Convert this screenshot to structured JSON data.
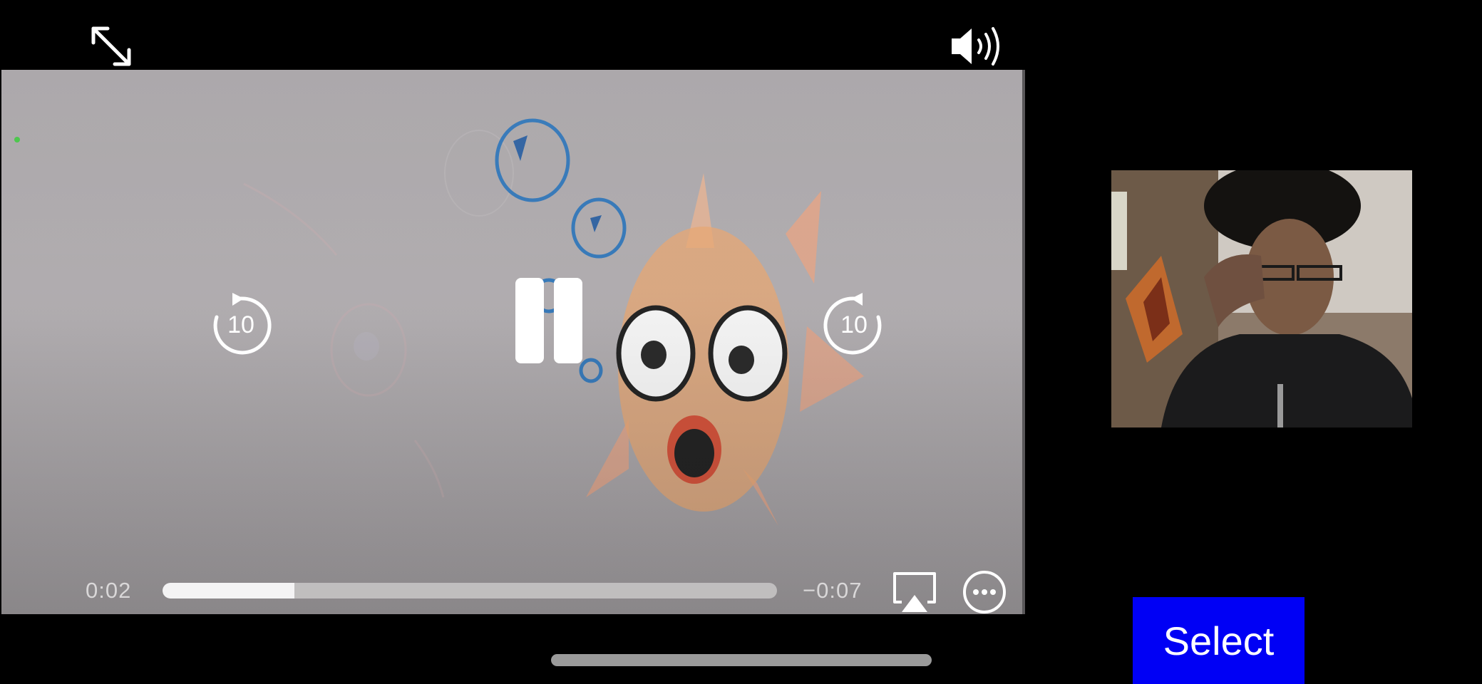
{
  "player": {
    "elapsed": "0:02",
    "remaining": "−0:07",
    "progress_fraction": 0.215,
    "skip_back_seconds": "10",
    "skip_forward_seconds": "10"
  },
  "icons": {
    "fullscreen": "expand-arrows-icon",
    "volume": "speaker-volume-icon",
    "rewind": "skip-back-10-icon",
    "pause": "pause-icon",
    "forward": "skip-forward-10-icon",
    "airplay": "airplay-icon",
    "more": "ellipsis-circle-icon"
  },
  "pip": {
    "description_icon": "camera-preview"
  },
  "actions": {
    "select_label": "Select"
  },
  "colors": {
    "select_button": "#0000f5",
    "background": "#000000"
  }
}
